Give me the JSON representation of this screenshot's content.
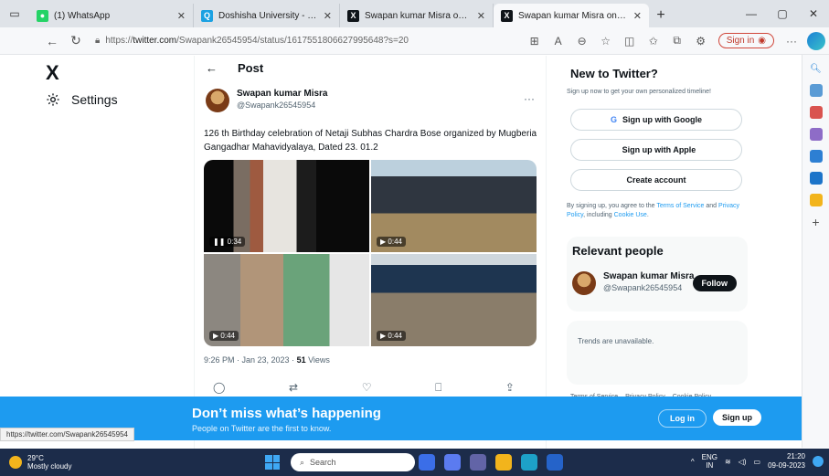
{
  "browser": {
    "tabs": [
      {
        "title": "(1) WhatsApp",
        "icon": "whatsapp-icon",
        "color": "#25d366"
      },
      {
        "title": "Doshisha University - Bing image",
        "icon": "bing-search-icon",
        "color": "#1ba1e2"
      },
      {
        "title": "Swapan kumar Misra on X: \"126",
        "icon": "x-icon",
        "color": "#0f1419"
      },
      {
        "title": "Swapan kumar Misra on X: \"126",
        "icon": "x-icon",
        "color": "#0f1419"
      }
    ],
    "address_prefix": "https://",
    "address_domain": "twitter.com",
    "address_path": "/Swapank26545954/status/1617551806627995648?s=20",
    "signin_label": "Sign in"
  },
  "sidebar": {
    "logo": "X",
    "settings_label": "Settings"
  },
  "post": {
    "header": "Post",
    "author_name": "Swapan kumar Misra",
    "author_handle": "@Swapank26545954",
    "more": "···",
    "text": "126 th Birthday celebration of Netaji Subhas Chardra Bose organized by Mugberia Gangadhar Mahavidyalaya,  Dated 23. 01.2",
    "media": [
      {
        "time": "0:34",
        "state": "pause"
      },
      {
        "time": "0:44",
        "state": "play"
      },
      {
        "time": "0:44",
        "state": "play"
      },
      {
        "time": "0:44",
        "state": "play"
      }
    ],
    "timestamp": "9:26 PM · Jan 23, 2023 · ",
    "views_count": "51",
    "views_label": " Views"
  },
  "right": {
    "new_title": "New to Twitter?",
    "new_sub": "Sign up now to get your own personalized timeline!",
    "google_btn": "Sign up with Google",
    "apple_btn": "Sign up with Apple",
    "create_btn": "Create account",
    "terms_pre": "By signing up, you agree to the ",
    "terms_tos": "Terms of Service",
    "terms_and": " and ",
    "terms_privacy": "Privacy Policy",
    "terms_incl": ", including ",
    "terms_cookie": "Cookie Use",
    "terms_end": ".",
    "relevant_title": "Relevant people",
    "rel_name": "Swapan kumar Misra",
    "rel_handle": "@Swapank26545954",
    "follow_label": "Follow",
    "trends": "Trends are unavailable.",
    "footer": [
      "Terms of Service",
      "Privacy Policy",
      "Cookie Policy"
    ]
  },
  "banner": {
    "headline": "Don’t miss what’s happening",
    "sub": "People on Twitter are the first to know.",
    "login": "Log in",
    "signup": "Sign up"
  },
  "status_url": "https://twitter.com/Swapank26545954",
  "taskbar": {
    "temp": "29°C",
    "weather": "Mostly cloudy",
    "search": "Search",
    "lang_top": "ENG",
    "lang_bottom": "IN",
    "time": "21:20",
    "date": "09-09-2023"
  }
}
